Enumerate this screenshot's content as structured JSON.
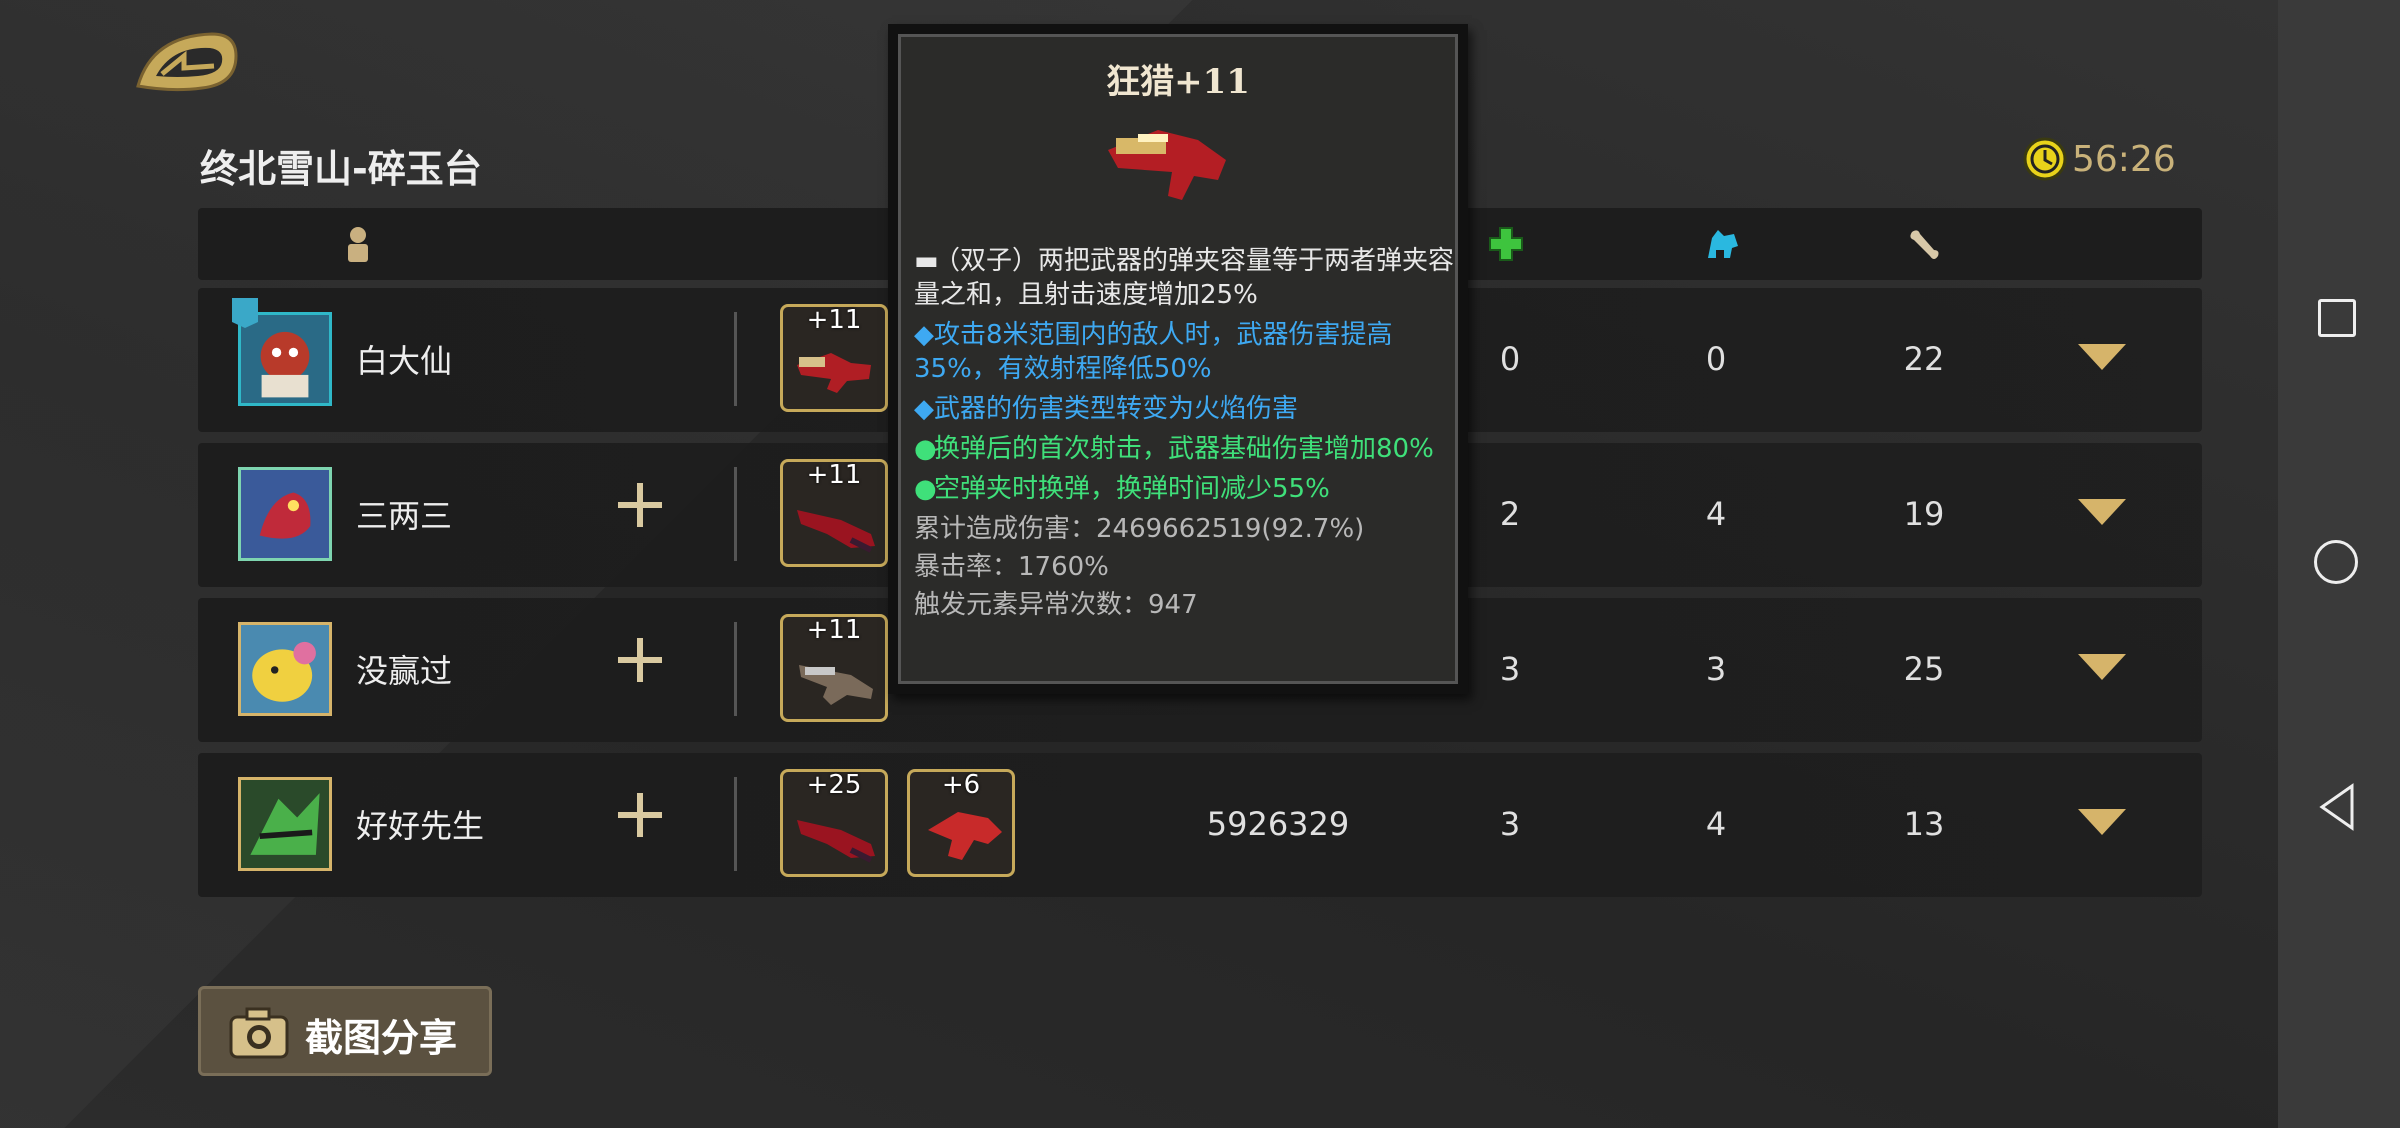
{
  "stage": {
    "title": "终北雪山-碎玉台",
    "timer": "56:26"
  },
  "players": [
    {
      "name": "白大仙",
      "weapons": [
        "+11"
      ],
      "damage": "",
      "heal": "0",
      "pet": "0",
      "kills": "22"
    },
    {
      "name": "三两三",
      "weapons": [
        "+11"
      ],
      "damage": "",
      "heal": "2",
      "pet": "4",
      "kills": "19"
    },
    {
      "name": "没赢过",
      "weapons": [
        "+11"
      ],
      "damage": "",
      "heal": "3",
      "pet": "3",
      "kills": "25"
    },
    {
      "name": "好好先生",
      "weapons": [
        "+25",
        "+6"
      ],
      "damage": "5926329",
      "heal": "3",
      "pet": "4",
      "kills": "13"
    }
  ],
  "tooltip": {
    "title": "狂猎+11",
    "lines": [
      {
        "type": "white",
        "text": "（双子）两把武器的弹夹容量等于两者弹夹容量之和，且射击速度增加25%"
      },
      {
        "type": "blue",
        "text": "攻击8米范围内的敌人时，武器伤害提高35%，有效射程降低50%"
      },
      {
        "type": "blue",
        "text": "武器的伤害类型转变为火焰伤害"
      },
      {
        "type": "green",
        "text": "换弹后的首次射击，武器基础伤害增加80%"
      },
      {
        "type": "green",
        "text": "空弹夹时换弹，换弹时间减少55%"
      }
    ],
    "stats": [
      "累计造成伤害：2469662519(92.7%)",
      "暴击率：1760%",
      "触发元素异常次数：947"
    ]
  },
  "share_button": {
    "label": "截图分享"
  },
  "colors": {
    "accent": "#d6b46a",
    "blue_text": "#3ea9f2",
    "green_text": "#3fe07a"
  }
}
